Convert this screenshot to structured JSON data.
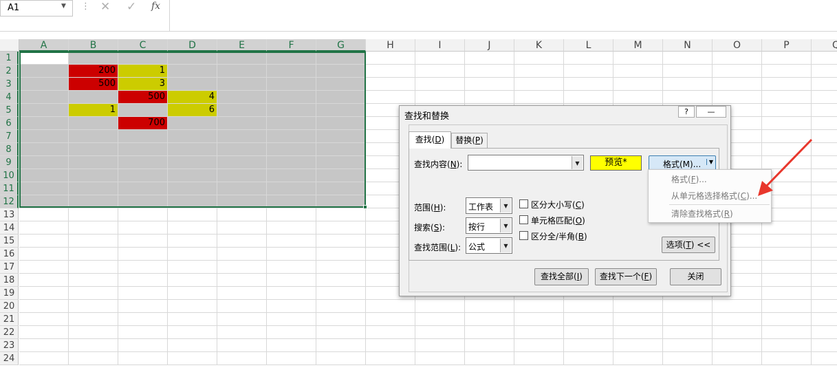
{
  "formula_bar": {
    "name_box": "A1",
    "dots": "⋮",
    "cancel": "✕",
    "enter": "✓",
    "fx": "fx"
  },
  "columns": [
    "A",
    "B",
    "C",
    "D",
    "E",
    "F",
    "G",
    "H",
    "I",
    "J",
    "K",
    "L",
    "M",
    "N",
    "O",
    "P",
    "Q"
  ],
  "rows": [
    "1",
    "2",
    "3",
    "4",
    "5",
    "6",
    "7",
    "8",
    "9",
    "10",
    "11",
    "12",
    "13",
    "14",
    "15",
    "16",
    "17",
    "18",
    "19",
    "20",
    "21",
    "22",
    "23",
    "24"
  ],
  "selection": "A1:G12",
  "cells": [
    {
      "ref": "B2",
      "value": "200",
      "fill": "red"
    },
    {
      "ref": "C2",
      "value": "1",
      "fill": "yellow"
    },
    {
      "ref": "B3",
      "value": "500",
      "fill": "red"
    },
    {
      "ref": "C3",
      "value": "3",
      "fill": "yellow"
    },
    {
      "ref": "C4",
      "value": "500",
      "fill": "red"
    },
    {
      "ref": "D4",
      "value": "4",
      "fill": "yellow"
    },
    {
      "ref": "B5",
      "value": "1",
      "fill": "yellow"
    },
    {
      "ref": "D5",
      "value": "6",
      "fill": "yellow"
    },
    {
      "ref": "C6",
      "value": "700",
      "fill": "red"
    }
  ],
  "colors": {
    "red": "#cc0000",
    "yellow": "#cccc00",
    "selection_gray": "#c6c6c6",
    "accent_green": "#217346",
    "preview_yellow": "#ffff00"
  },
  "dialog": {
    "title": "查找和替换",
    "help": "?",
    "title_minimize": "—",
    "tab_find": "查找(",
    "tab_find_key": "D",
    "tab_replace": "替换(",
    "tab_replace_key": "P",
    "find_what_label": "查找内容(",
    "find_what_key": "N",
    "find_what_value": "",
    "preview": "预览*",
    "format_button": "格式(M)...",
    "within_label": "范围(",
    "within_key": "H",
    "within_value": "工作表",
    "search_label": "搜索(",
    "search_key": "S",
    "search_value": "按行",
    "look_in_label": "查找范围(",
    "look_in_key": "L",
    "look_in_value": "公式",
    "match_case": "区分大小写(",
    "match_case_key": "C",
    "match_entire": "单元格匹配(",
    "match_entire_key": "O",
    "match_byte": "区分全/半角(",
    "match_byte_key": "B",
    "options_button": "选项(",
    "options_key": "T",
    "options_suffix": ") <<",
    "find_all": "查找全部(",
    "find_all_key": "I",
    "find_next": "查找下一个(",
    "find_next_key": "F",
    "close": "关闭",
    "close_paren": ")",
    "colon_paren": "):"
  },
  "format_menu": {
    "items": [
      {
        "label": "格式(",
        "key": "F",
        "suffix": ")..."
      },
      {
        "label": "从单元格选择格式(",
        "key": "C",
        "suffix": ")..."
      },
      {
        "label": "清除查找格式(",
        "key": "R",
        "suffix": ")"
      }
    ]
  }
}
